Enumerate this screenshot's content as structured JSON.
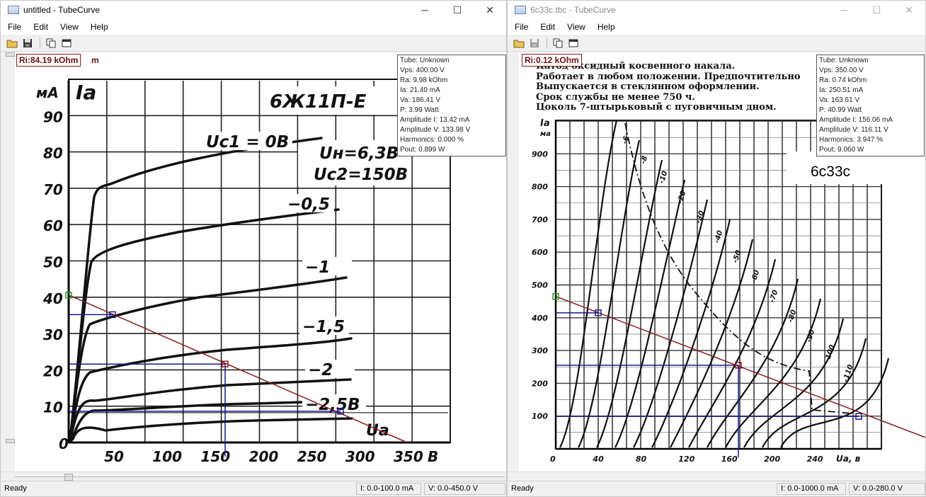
{
  "left_window": {
    "title": "untitled - TubeCurve",
    "menu": [
      "File",
      "Edit",
      "View",
      "Help"
    ],
    "ri_label": "Ri:84.19 kOhm",
    "ri_trailing_char": "m",
    "info": [
      "Tube: Unknown",
      "Vps: 400.00 V",
      "Ra: 9.98 kOhm",
      "Ia: 21.40 mA",
      "Va: 186.41 V",
      "P: 3.99 Watt",
      "Amplitude I: 13.42 mA",
      "Amplitude V: 133.98 V",
      "Harmonics: 0.000 %",
      "Pout: 0.899 W"
    ],
    "status": {
      "ready": "Ready",
      "current_range": "I: 0.0-100.0 mA",
      "voltage_range": "V: 0.0-450.0 V"
    },
    "sheet": {
      "ylabel_units": "мА",
      "ylabel": "Ia",
      "tube_name": "6Ж11П-Е",
      "uh": "Uн=6,3В",
      "uc2": "Uс2=150В",
      "xlabel": "Ua",
      "x_unit": "В",
      "y_ticks": [
        "90",
        "80",
        "70",
        "60",
        "50",
        "40",
        "30",
        "20",
        "10",
        "0"
      ],
      "x_ticks": [
        "50",
        "100",
        "150",
        "200",
        "250",
        "300",
        "350"
      ],
      "curve_labels": [
        "Uс1 = 0В",
        "−0,5",
        "−1",
        "−1,5",
        "−2",
        "−2,5В"
      ]
    }
  },
  "right_window": {
    "title": "6c33c.tbc - TubeCurve",
    "menu": [
      "File",
      "Edit",
      "View",
      "Help"
    ],
    "ri_label": "Ri:0.12 kOhm",
    "info": [
      "Tube: Unknown",
      "Vps: 350.00 V",
      "Ra: 0.74 kOhm",
      "Ia: 250.51 mA",
      "Va: 163.61 V",
      "P: 40.99 Watt",
      "Amplitude I: 156.06 mA",
      "Amplitude V: 116.11 V",
      "Harmonics: 3.947 %",
      "Pout: 9.060 W"
    ],
    "status": {
      "ready": "Ready",
      "current_range": "I: 0.0-1000.0 mA",
      "voltage_range": "V: 0.0-280.0 V"
    },
    "tube_caption": "6c33c",
    "sheet": {
      "text_lines": [
        "Катод оксидный косвенного накала.",
        "Работает в любом положении. Предпочтительно",
        "Выпускается в стеклянном оформлении.",
        "Срок службы не менее 750 ч.",
        "Цоколь 7-штырьковый с пуговичным дном."
      ],
      "ylabel": "Ia",
      "ylabel_units": "ма",
      "y_ticks": [
        "900",
        "800",
        "700",
        "600",
        "500",
        "400",
        "300",
        "200",
        "100"
      ],
      "x_ticks": [
        "0",
        "40",
        "80",
        "120",
        "160",
        "200",
        "240"
      ],
      "xlabel": "Ua, в",
      "curve_labels": [
        "-6",
        "-8",
        "-10",
        "-20",
        "-30",
        "-40",
        "-50",
        "-60",
        "-70",
        "-80",
        "-90",
        "-100",
        "-110"
      ]
    }
  },
  "colors": {
    "loadline": "#8b1a1a",
    "bias": "#1a1a8b",
    "grid": "#111111"
  }
}
